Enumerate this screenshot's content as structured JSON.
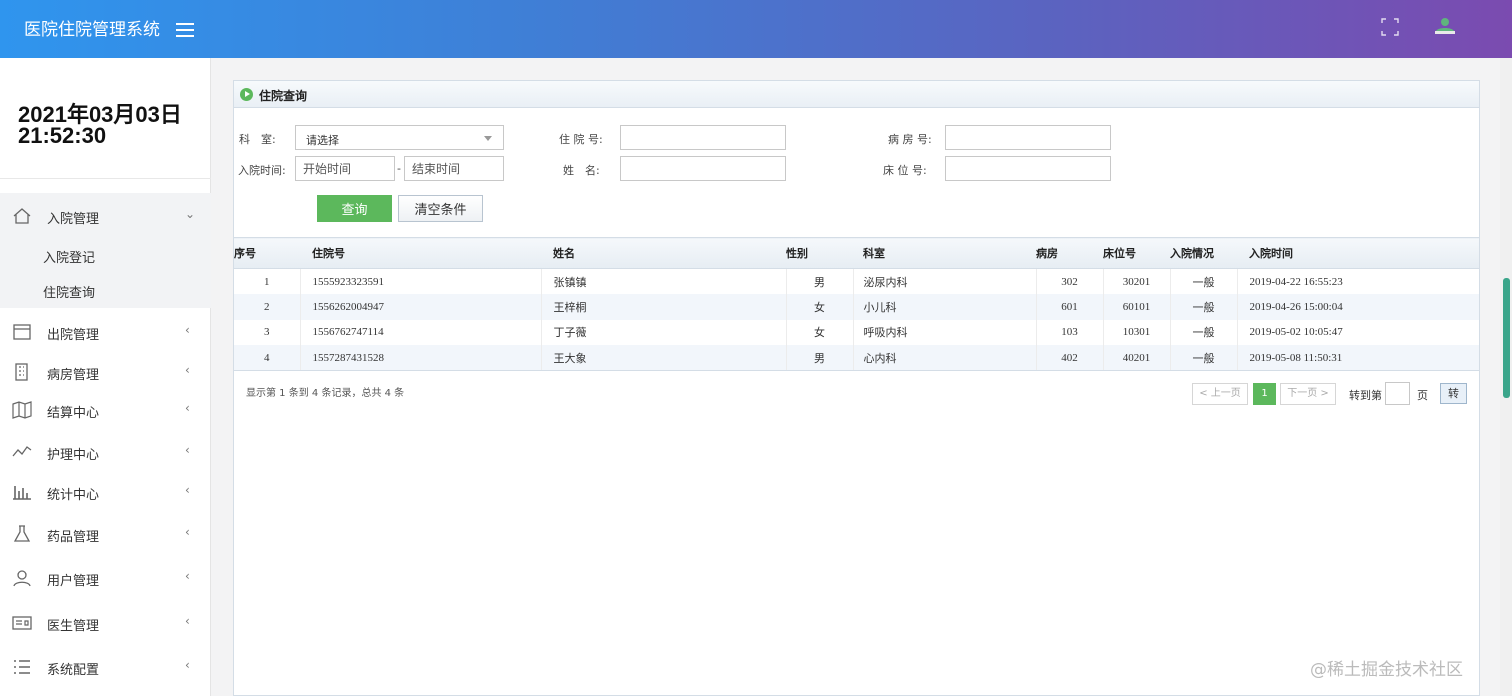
{
  "header": {
    "title": "医院住院管理系统"
  },
  "sidebar": {
    "date_line": "2021年03月03日",
    "time_line": "21:52:30",
    "menu": [
      {
        "label": "入院管理",
        "icon": "home-icon",
        "expanded": true,
        "children": [
          {
            "label": "入院登记"
          },
          {
            "label": "住院查询"
          }
        ]
      },
      {
        "label": "出院管理",
        "icon": "window-icon"
      },
      {
        "label": "病房管理",
        "icon": "building-icon"
      },
      {
        "label": "结算中心",
        "icon": "map-icon"
      },
      {
        "label": "护理中心",
        "icon": "line-chart-icon"
      },
      {
        "label": "统计中心",
        "icon": "bar-chart-icon"
      },
      {
        "label": "药品管理",
        "icon": "flask-icon"
      },
      {
        "label": "用户管理",
        "icon": "user-icon"
      },
      {
        "label": "医生管理",
        "icon": "id-card-icon"
      },
      {
        "label": "系统配置",
        "icon": "list-icon"
      }
    ],
    "arrow_open": "⌄",
    "arrow_closed": "‹"
  },
  "panel": {
    "title": "住院查询",
    "form": {
      "dept_label": "科　室:",
      "dept_value": "请选择",
      "admit_no_label": "住 院 号:",
      "ward_label": "病 房 号:",
      "admit_time_label": "入院时间:",
      "start_placeholder": "开始时间",
      "dash": "-",
      "end_placeholder": "结束时间",
      "name_label": "姓　名:",
      "bed_label": "床 位 号:",
      "query_button": "查询",
      "clear_button": "清空条件"
    },
    "table": {
      "columns": [
        "序号",
        "住院号",
        "姓名",
        "性别",
        "科室",
        "病房",
        "床位号",
        "入院情况",
        "入院时间"
      ],
      "rows": [
        [
          "1",
          "1555923323591",
          "张镇镇",
          "男",
          "泌尿内科",
          "302",
          "30201",
          "一般",
          "2019-04-22 16:55:23"
        ],
        [
          "2",
          "1556262004947",
          "王梓桐",
          "女",
          "小儿科",
          "601",
          "60101",
          "一般",
          "2019-04-26 15:00:04"
        ],
        [
          "3",
          "1556762747114",
          "丁子薇",
          "女",
          "呼吸内科",
          "103",
          "10301",
          "一般",
          "2019-05-02 10:05:47"
        ],
        [
          "4",
          "1557287431528",
          "王大象",
          "男",
          "心内科",
          "402",
          "40201",
          "一般",
          "2019-05-08 11:50:31"
        ]
      ]
    },
    "pager": {
      "info": "显示第 1 条到 4 条记录，总共 4 条",
      "prev": "< 上一页",
      "current": "1",
      "next": "下一页 >",
      "goto_label": "转到第",
      "page_unit": "页",
      "goto_button": "转"
    }
  },
  "watermark": "@稀土掘金技术社区"
}
